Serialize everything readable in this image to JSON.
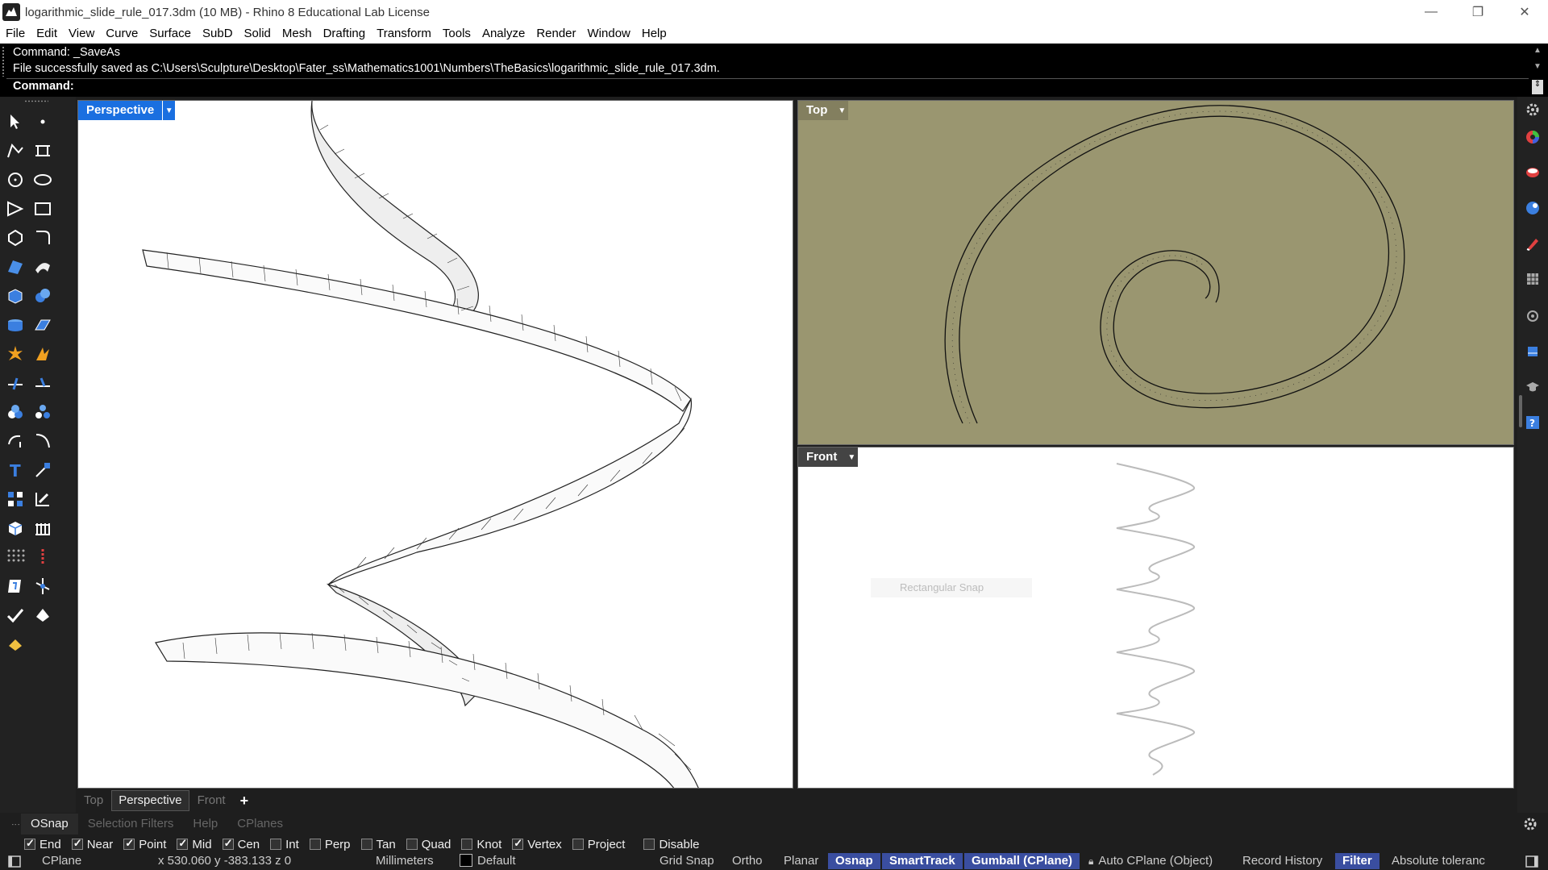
{
  "window": {
    "title": "logarithmic_slide_rule_017.3dm (10 MB) - Rhino 8 Educational Lab License",
    "minimize": "—",
    "restore": "❐",
    "close": "✕"
  },
  "menu": [
    "File",
    "Edit",
    "View",
    "Curve",
    "Surface",
    "SubD",
    "Solid",
    "Mesh",
    "Drafting",
    "Transform",
    "Tools",
    "Analyze",
    "Render",
    "Window",
    "Help"
  ],
  "command": {
    "history_1": "Command: _SaveAs",
    "history_2": "File successfully saved as C:\\Users\\Sculpture\\Desktop\\Fater_ss\\Mathematics1001\\Numbers\\TheBasics\\logarithmic_slide_rule_017.3dm.",
    "prompt": "Command:"
  },
  "viewports": {
    "perspective": {
      "label": "Perspective",
      "active": true
    },
    "top": {
      "label": "Top",
      "background": "#9a9670"
    },
    "front": {
      "label": "Front",
      "ghost_tooltip": "Rectangular Snap"
    }
  },
  "viewport_tabs": [
    "Top",
    "Perspective",
    "Front",
    "+"
  ],
  "viewport_tabs_active": "Perspective",
  "panel_tabs": [
    "OSnap",
    "Selection Filters",
    "Help",
    "CPlanes"
  ],
  "panel_tabs_active": "OSnap",
  "osnap": [
    {
      "label": "End",
      "checked": true
    },
    {
      "label": "Near",
      "checked": true
    },
    {
      "label": "Point",
      "checked": true
    },
    {
      "label": "Mid",
      "checked": true
    },
    {
      "label": "Cen",
      "checked": true
    },
    {
      "label": "Int",
      "checked": false
    },
    {
      "label": "Perp",
      "checked": false
    },
    {
      "label": "Tan",
      "checked": false
    },
    {
      "label": "Quad",
      "checked": false
    },
    {
      "label": "Knot",
      "checked": false
    },
    {
      "label": "Vertex",
      "checked": true
    },
    {
      "label": "Project",
      "checked": false
    },
    {
      "label": "Disable",
      "checked": false
    }
  ],
  "status": {
    "cplane": "CPlane",
    "coords": "x 530.060  y -383.133  z 0",
    "units": "Millimeters",
    "layer": "Default",
    "grid_snap": "Grid Snap",
    "ortho": "Ortho",
    "planar": "Planar",
    "osnap": "Osnap",
    "smarttrack": "SmartTrack",
    "gumball": "Gumball (CPlane)",
    "auto_cplane": "Auto CPlane (Object)",
    "record_history": "Record History",
    "filter": "Filter",
    "tolerance": "Absolute toleranc"
  },
  "colors": {
    "active_viewport_label": "#1a6fe0",
    "top_viewport_bg": "#9a9670",
    "status_pill": "#3a4ea0"
  }
}
